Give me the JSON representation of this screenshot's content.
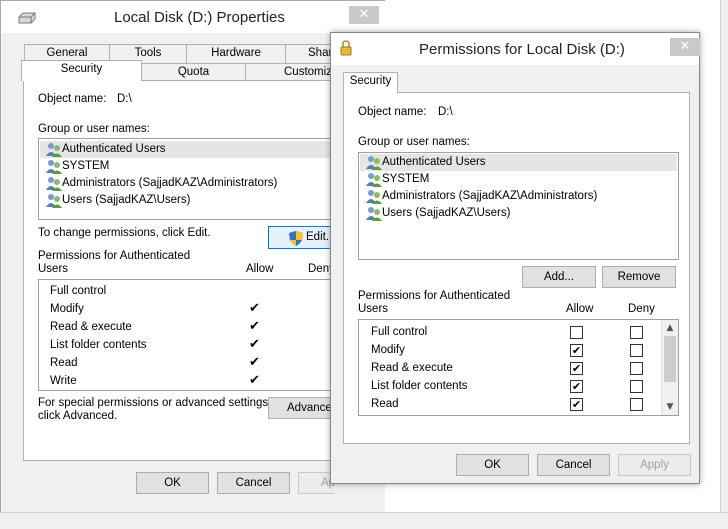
{
  "back": {
    "title": "Local Disk (D:) Properties",
    "close": "✕",
    "tabs_row1": [
      "General",
      "Tools",
      "Hardware",
      "Shar"
    ],
    "tabs_row2": [
      "Security",
      "Quota",
      "Customize"
    ],
    "object_name_label": "Object name:",
    "object_name_value": "D:\\",
    "group_label": "Group or user names:",
    "users": [
      "Authenticated Users",
      "SYSTEM",
      "Administrators (SajjadKAZ\\Administrators)",
      "Users (SajjadKAZ\\Users)"
    ],
    "change_text": "To change permissions, click Edit.",
    "edit_label": "Edit...",
    "perm_header_line1": "Permissions for Authenticated",
    "perm_header_line2": "Users",
    "allow": "Allow",
    "deny": "Deny",
    "permissions": [
      {
        "name": "Full control",
        "allow": false
      },
      {
        "name": "Modify",
        "allow": true
      },
      {
        "name": "Read & execute",
        "allow": true
      },
      {
        "name": "List folder contents",
        "allow": true
      },
      {
        "name": "Read",
        "allow": true
      },
      {
        "name": "Write",
        "allow": true
      }
    ],
    "checkmark": "✔",
    "special_line1": "For special permissions or advanced settings,",
    "special_line2": "click Advanced.",
    "advanced_label": "Advance",
    "ok": "OK",
    "cancel": "Cancel",
    "apply": "Ap"
  },
  "front": {
    "title": "Permissions for Local Disk (D:)",
    "close": "✕",
    "tab": "Security",
    "object_name_label": "Object name:",
    "object_name_value": "D:\\",
    "group_label": "Group or user names:",
    "users": [
      "Authenticated Users",
      "SYSTEM",
      "Administrators (SajjadKAZ\\Administrators)",
      "Users (SajjadKAZ\\Users)"
    ],
    "add_label": "Add...",
    "remove_label": "Remove",
    "perm_header_line1": "Permissions for Authenticated",
    "perm_header_line2": "Users",
    "allow": "Allow",
    "deny": "Deny",
    "permissions": [
      {
        "name": "Full control",
        "allow": false,
        "deny": false
      },
      {
        "name": "Modify",
        "allow": true,
        "deny": false
      },
      {
        "name": "Read & execute",
        "allow": true,
        "deny": false
      },
      {
        "name": "List folder contents",
        "allow": true,
        "deny": false
      },
      {
        "name": "Read",
        "allow": true,
        "deny": false
      }
    ],
    "checkmark": "✔",
    "scroll_up": "▲",
    "scroll_down": "▼",
    "ok": "OK",
    "cancel": "Cancel",
    "apply": "Apply"
  }
}
